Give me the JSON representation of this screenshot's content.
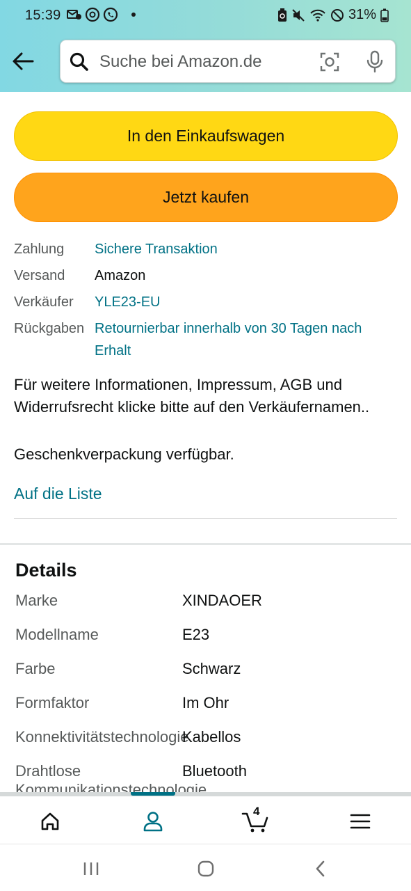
{
  "status_bar": {
    "time": "15:39",
    "battery": "31%",
    "left_icons": [
      "voicemail-icon",
      "threads-icon",
      "whatsapp-icon",
      "dot-icon"
    ],
    "right_icons": [
      "recycle-battery-icon",
      "mute-icon",
      "wifi-icon",
      "do-not-disturb-icon",
      "battery-icon"
    ]
  },
  "search": {
    "placeholder": "Suche bei Amazon.de"
  },
  "buttons": {
    "add_to_cart": "In den Einkaufswagen",
    "buy_now": "Jetzt kaufen"
  },
  "info": [
    {
      "label": "Zahlung",
      "value": "Sichere Transaktion",
      "link": true
    },
    {
      "label": "Versand",
      "value": "Amazon",
      "link": false
    },
    {
      "label": "Verkäufer",
      "value": "YLE23-EU",
      "link": true
    },
    {
      "label": "Rückgaben",
      "value": "Retournierbar innerhalb von 30 Tagen nach Erhalt",
      "link": true
    }
  ],
  "description": "Für weitere Informationen, Impressum, AGB und Widerrufsrecht klicke bitte auf den Verkäufernamen..",
  "gift_wrap": "Geschenkverpackung verfügbar.",
  "add_to_list": "Auf die Liste",
  "details": {
    "title": "Details",
    "rows": [
      {
        "label": "Marke",
        "value": "XINDAOER"
      },
      {
        "label": "Modellname",
        "value": "E23"
      },
      {
        "label": "Farbe",
        "value": "Schwarz"
      },
      {
        "label": "Formfaktor",
        "value": "Im Ohr"
      },
      {
        "label": "Konnektivitätstechnologie",
        "value": "Kabellos"
      },
      {
        "label": "Drahtlose",
        "value": "Bluetooth"
      },
      {
        "label": "Kommunikationstechnologie",
        "value": ""
      }
    ]
  },
  "bottom_nav": {
    "items": [
      "home-icon",
      "account-icon",
      "cart-icon",
      "menu-icon"
    ],
    "cart_count": "4",
    "active": "account"
  },
  "colors": {
    "link": "#007185",
    "cart_button": "#FFD814",
    "buy_button": "#FFA41C"
  }
}
